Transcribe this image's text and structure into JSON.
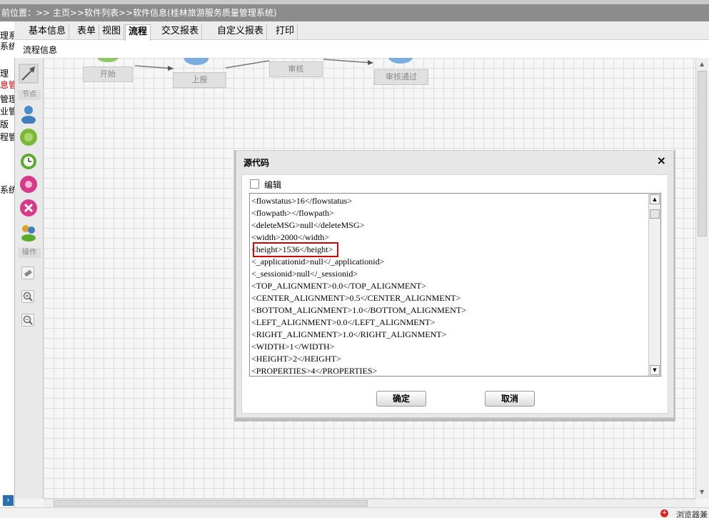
{
  "breadcrumb": "前位置：>> 主页>>软件列表>>软件信息(桂林旅游服务质量管理系统)",
  "left_nav": [
    {
      "label": "理系",
      "red": false
    },
    {
      "label": "系统",
      "red": false
    },
    {
      "label": "理",
      "red": false
    },
    {
      "label": "息管",
      "red": true
    },
    {
      "label": "管理",
      "red": false
    },
    {
      "label": "业管理",
      "red": false
    },
    {
      "label": "版",
      "red": false
    },
    {
      "label": "程管",
      "red": false
    },
    {
      "label": "系统",
      "red": false
    }
  ],
  "tabs": [
    {
      "label": "基本信息",
      "active": false
    },
    {
      "label": "表单",
      "active": false
    },
    {
      "label": "视图",
      "active": false
    },
    {
      "label": "流程",
      "active": true
    },
    {
      "label": "交叉报表",
      "active": false
    },
    {
      "label": "自定义报表",
      "active": false
    },
    {
      "label": "打印",
      "active": false
    }
  ],
  "subbar_label": "流程信息",
  "toolbox": {
    "nodes_label": "节点",
    "ops_label": "操作"
  },
  "flow_nodes": [
    "开始",
    "上报",
    "审核",
    "审核通过"
  ],
  "dialog": {
    "title": "源代码",
    "close": "×",
    "edit_label": "编辑",
    "code_lines": [
      "<flowstatus>16</flowstatus>",
      "<flowpath></flowpath>",
      "<deleteMSG>null</deleteMSG>",
      "<width>2000</width>",
      "<height>1536</height>",
      "<_applicationid>null</_applicationid>",
      "<_sessionid>null</_sessionid>",
      "<TOP_ALIGNMENT>0.0</TOP_ALIGNMENT>",
      "<CENTER_ALIGNMENT>0.5</CENTER_ALIGNMENT>",
      "<BOTTOM_ALIGNMENT>1.0</BOTTOM_ALIGNMENT>",
      "<LEFT_ALIGNMENT>0.0</LEFT_ALIGNMENT>",
      "<RIGHT_ALIGNMENT>1.0</RIGHT_ALIGNMENT>",
      "<WIDTH>1</WIDTH>",
      "<HEIGHT>2</HEIGHT>",
      "<PROPERTIES>4</PROPERTIES>"
    ],
    "ok_label": "确定",
    "cancel_label": "取消"
  },
  "statusbar": "浏览器兼"
}
